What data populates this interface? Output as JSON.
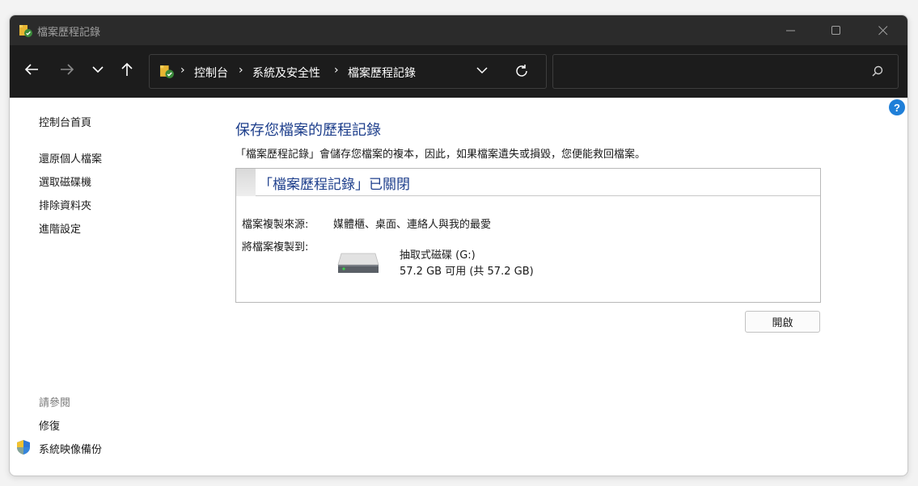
{
  "window": {
    "title": "檔案歷程記錄"
  },
  "address": {
    "crumbs": [
      "控制台",
      "系統及安全性",
      "檔案歷程記錄"
    ],
    "separator": "›"
  },
  "search": {
    "placeholder": ""
  },
  "help": {
    "label": "?"
  },
  "sidebar": {
    "home": "控制台首頁",
    "items": [
      "還原個人檔案",
      "選取磁碟機",
      "排除資料夾",
      "進階設定"
    ],
    "see_also_heading": "請參閱",
    "see_also": [
      "修復",
      "系統映像備份"
    ]
  },
  "main": {
    "title": "保存您檔案的歷程記錄",
    "description": "「檔案歷程記錄」會儲存您檔案的複本，因此，如果檔案遺失或損毀，您便能救回檔案。",
    "panel": {
      "status": "「檔案歷程記錄」已關閉",
      "source_label": "檔案複製來源:",
      "source_value": "媒體櫃、桌面、連絡人與我的最愛",
      "dest_label": "將檔案複製到:",
      "drive_name": "抽取式磁碟 (G:)",
      "drive_size": "57.2 GB 可用 (共 57.2 GB)"
    },
    "open_button": "開啟"
  },
  "colors": {
    "accent": "#1e3f8c",
    "titlebar": "#2b2b2b",
    "navbar": "#1c1c1c",
    "help": "#1f7fd8"
  },
  "icons": [
    "folder-icon",
    "back-arrow-icon",
    "forward-arrow-icon",
    "chevron-down-icon",
    "up-arrow-icon",
    "refresh-icon",
    "search-icon",
    "shield-icon",
    "drive-icon",
    "help-icon"
  ]
}
